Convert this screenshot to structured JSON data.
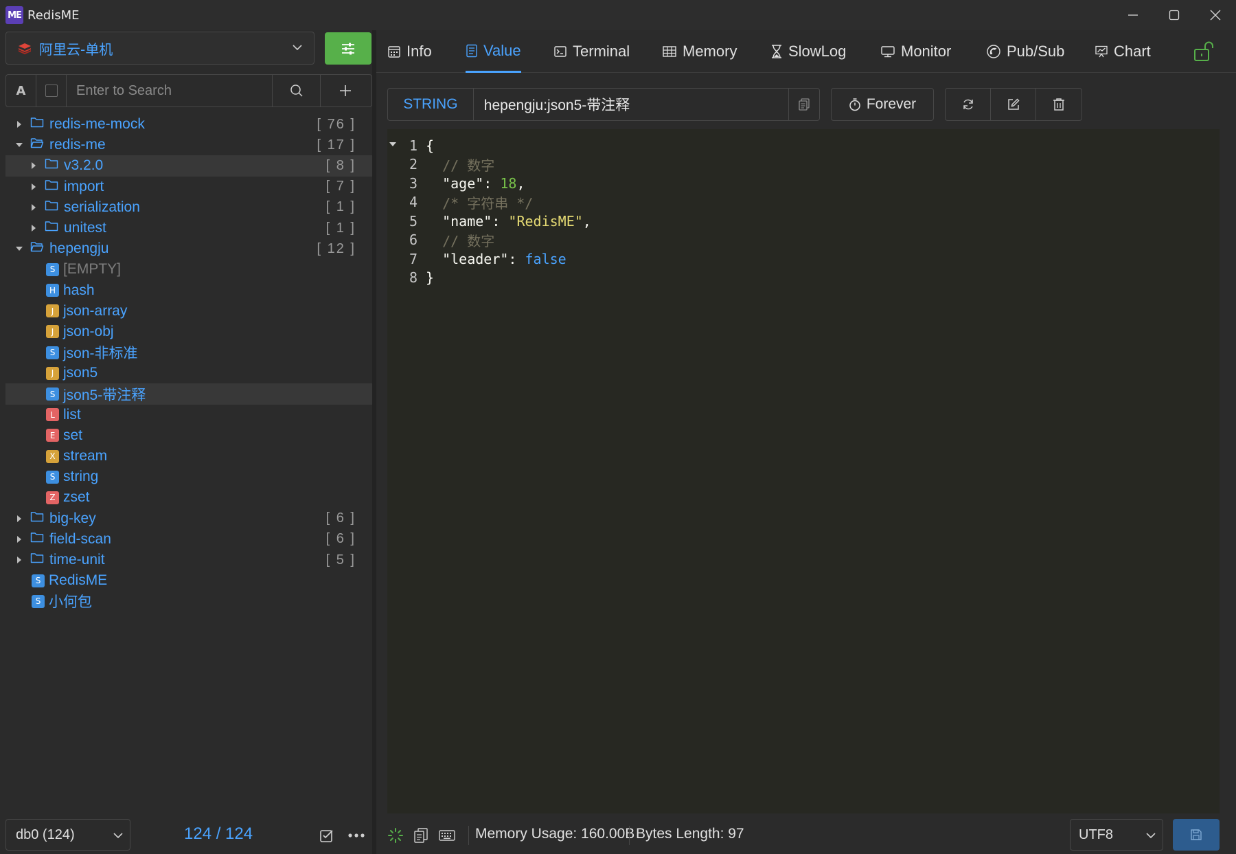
{
  "window": {
    "app_logo": "ME",
    "title": "RedisME",
    "controls": [
      "minimize-icon",
      "maximize-icon",
      "close-icon"
    ]
  },
  "connection": {
    "name": "阿里云-单机",
    "icon": "redis-icon"
  },
  "search": {
    "case_toggle": "A",
    "placeholder": "Enter to Search"
  },
  "tree": [
    {
      "depth": 0,
      "type": "folder",
      "expanded": false,
      "label": "redis-me-mock",
      "count": "[ 76 ]"
    },
    {
      "depth": 0,
      "type": "folder",
      "expanded": true,
      "label": "redis-me",
      "count": "[ 17 ]"
    },
    {
      "depth": 1,
      "type": "folder",
      "expanded": false,
      "label": "v3.2.0",
      "count": "[ 8 ]",
      "selected": true
    },
    {
      "depth": 1,
      "type": "folder",
      "expanded": false,
      "label": "import",
      "count": "[ 7 ]"
    },
    {
      "depth": 1,
      "type": "folder",
      "expanded": false,
      "label": "serialization",
      "count": "[ 1 ]"
    },
    {
      "depth": 1,
      "type": "folder",
      "expanded": false,
      "label": "unitest",
      "count": "[ 1 ]"
    },
    {
      "depth": 0,
      "type": "folder",
      "expanded": true,
      "label": "hepengju",
      "count": "[ 12 ]"
    },
    {
      "depth": 1,
      "type": "key",
      "badge": "S",
      "label": "[EMPTY]",
      "dim": true
    },
    {
      "depth": 1,
      "type": "key",
      "badge": "H",
      "label": "hash"
    },
    {
      "depth": 1,
      "type": "key",
      "badge": "J",
      "label": "json-array"
    },
    {
      "depth": 1,
      "type": "key",
      "badge": "J",
      "label": "json-obj"
    },
    {
      "depth": 1,
      "type": "key",
      "badge": "S",
      "label": "json-非标准"
    },
    {
      "depth": 1,
      "type": "key",
      "badge": "J",
      "label": "json5"
    },
    {
      "depth": 1,
      "type": "key",
      "badge": "S",
      "label": "json5-带注释",
      "selected": true
    },
    {
      "depth": 1,
      "type": "key",
      "badge": "L",
      "label": "list"
    },
    {
      "depth": 1,
      "type": "key",
      "badge": "E",
      "label": "set"
    },
    {
      "depth": 1,
      "type": "key",
      "badge": "X",
      "label": "stream"
    },
    {
      "depth": 1,
      "type": "key",
      "badge": "S",
      "label": "string"
    },
    {
      "depth": 1,
      "type": "key",
      "badge": "Z",
      "label": "zset"
    },
    {
      "depth": 0,
      "type": "folder",
      "expanded": false,
      "label": "big-key",
      "count": "[ 6 ]"
    },
    {
      "depth": 0,
      "type": "folder",
      "expanded": false,
      "label": "field-scan",
      "count": "[ 6 ]"
    },
    {
      "depth": 0,
      "type": "folder",
      "expanded": false,
      "label": "time-unit",
      "count": "[ 5 ]"
    },
    {
      "depth": 0,
      "type": "key",
      "badge": "S",
      "label": "RedisME"
    },
    {
      "depth": 0,
      "type": "key",
      "badge": "S",
      "label": "小何包"
    }
  ],
  "left_footer": {
    "db": "db0 (124)",
    "key_count": "124 / 124"
  },
  "tabs": [
    {
      "label": "Info",
      "icon": "calendar-icon"
    },
    {
      "label": "Value",
      "icon": "document-icon",
      "active": true
    },
    {
      "label": "Terminal",
      "icon": "terminal-icon"
    },
    {
      "label": "Memory",
      "icon": "table-icon"
    },
    {
      "label": "SlowLog",
      "icon": "hourglass-icon"
    },
    {
      "label": "Monitor",
      "icon": "monitor-icon"
    },
    {
      "label": "Pub/Sub",
      "icon": "broadcast-icon"
    },
    {
      "label": "Chart",
      "icon": "chart-icon"
    }
  ],
  "key_info": {
    "type": "STRING",
    "name": "hepengju:json5-带注释",
    "ttl": "Forever"
  },
  "editor": {
    "lines": [
      {
        "n": "1",
        "fold": true,
        "tokens": [
          {
            "t": "{",
            "c": "plain"
          }
        ]
      },
      {
        "n": "2",
        "tokens": [
          {
            "t": "  // 数字",
            "c": "comment"
          }
        ]
      },
      {
        "n": "3",
        "tokens": [
          {
            "t": "  \"age\"",
            "c": "key"
          },
          {
            "t": ": ",
            "c": "plain"
          },
          {
            "t": "18",
            "c": "num"
          },
          {
            "t": ",",
            "c": "plain"
          }
        ]
      },
      {
        "n": "4",
        "tokens": [
          {
            "t": "  /* 字符串 */",
            "c": "comment"
          }
        ]
      },
      {
        "n": "5",
        "tokens": [
          {
            "t": "  \"name\"",
            "c": "key"
          },
          {
            "t": ": ",
            "c": "plain"
          },
          {
            "t": "\"RedisME\"",
            "c": "str"
          },
          {
            "t": ",",
            "c": "plain"
          }
        ]
      },
      {
        "n": "6",
        "tokens": [
          {
            "t": "  // 数字",
            "c": "comment"
          }
        ]
      },
      {
        "n": "7",
        "tokens": [
          {
            "t": "  \"leader\"",
            "c": "key"
          },
          {
            "t": ": ",
            "c": "plain"
          },
          {
            "t": "false",
            "c": "bool"
          }
        ]
      },
      {
        "n": "8",
        "tokens": [
          {
            "t": "}",
            "c": "plain"
          }
        ]
      }
    ]
  },
  "status": {
    "memory_usage": "Memory Usage: 160.00B",
    "bytes_length": "Bytes Length: 97",
    "encoding": "UTF8"
  },
  "colors": {
    "accent": "#4aa3ff",
    "settings_button": "#57b04a",
    "save_button": "#2d5c8e"
  }
}
